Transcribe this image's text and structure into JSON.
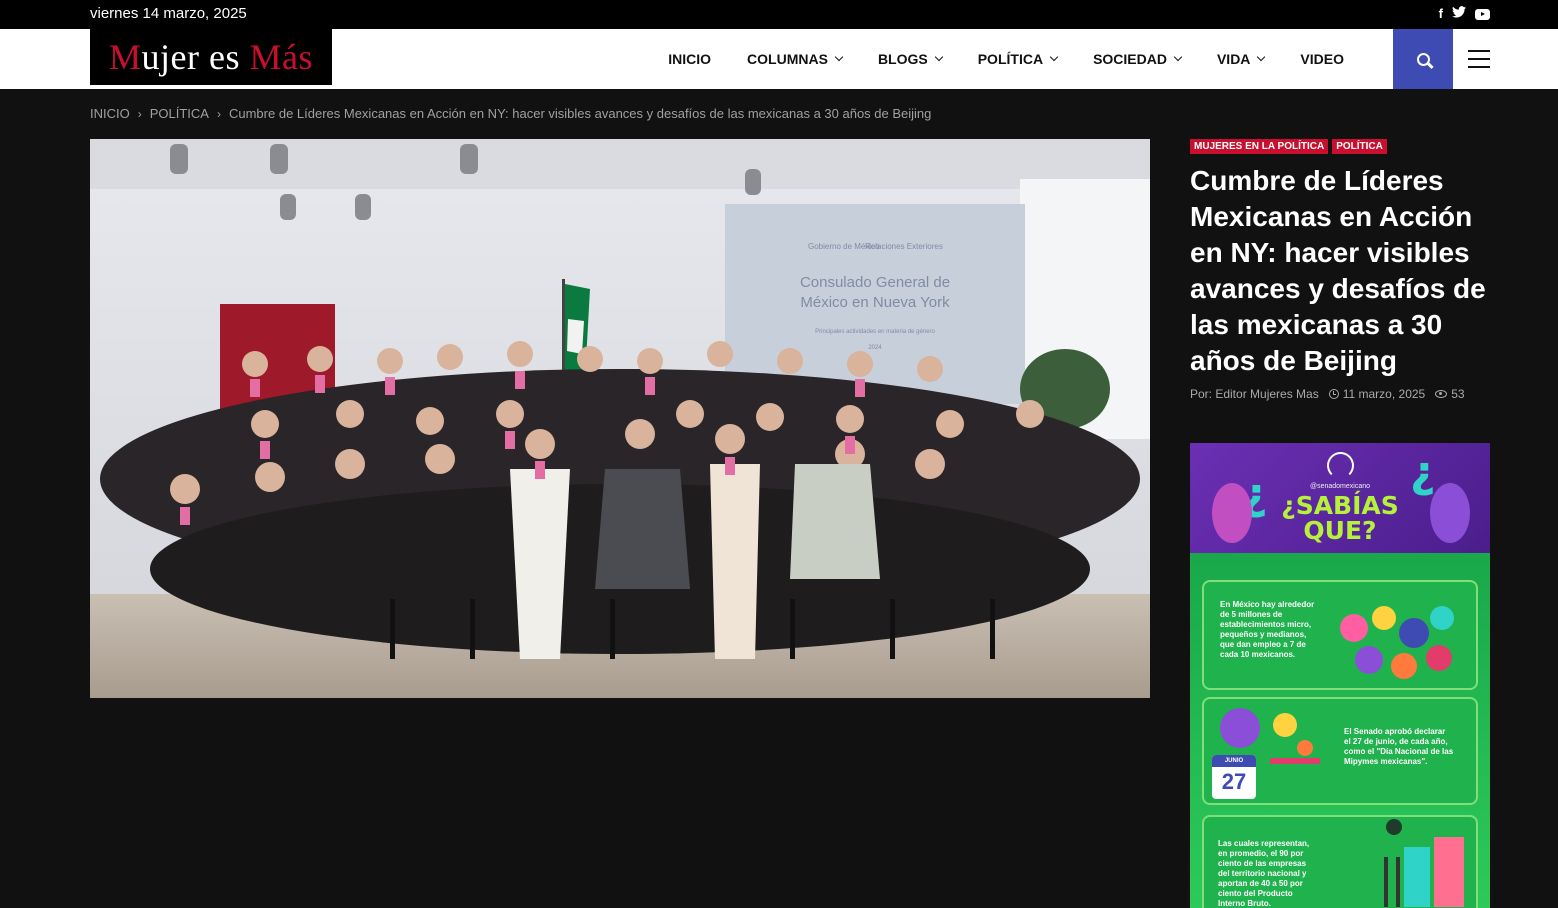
{
  "topbar": {
    "date": "viernes 14 marzo, 2025",
    "social": [
      "facebook-icon",
      "twitter-icon",
      "youtube-icon"
    ]
  },
  "header": {
    "logo": {
      "part1": "M",
      "part2": "ujer es ",
      "part3": "Más"
    },
    "nav": [
      {
        "label": "INICIO",
        "dropdown": false
      },
      {
        "label": "COLUMNAS",
        "dropdown": true
      },
      {
        "label": "BLOGS",
        "dropdown": true
      },
      {
        "label": "POLÍTICA",
        "dropdown": true
      },
      {
        "label": "SOCIEDAD",
        "dropdown": true
      },
      {
        "label": "VIDA",
        "dropdown": true
      },
      {
        "label": "VIDEO",
        "dropdown": false
      }
    ],
    "search_icon": "search-icon",
    "menu_icon": "hamburger-icon",
    "accent_color": "#3e4bb3"
  },
  "breadcrumb": {
    "home": "INICIO",
    "section": "POLÍTICA",
    "current": "Cumbre de Líderes Mexicanas en Acción en NY: hacer visibles avances y desafíos de las mexicanas a 30 años de Beijing"
  },
  "hero": {
    "screen_line1": "Consulado General de",
    "screen_line2": "México en Nueva York",
    "screen_sub": "Principales actividades en materia de género",
    "screen_year": "2024",
    "screen_brand1": "Gobierno de México",
    "screen_brand2": "Relaciones Exteriores"
  },
  "article": {
    "tags": [
      "MUJERES EN LA POLÍTICA",
      "POLÍTICA"
    ],
    "tag_color": "#c8102e",
    "title": "Cumbre de Líderes Mexicanas en Acción en NY: hacer visibles avances y desafíos de las mexicanas a 30 años de Beijing",
    "author": "Por: Editor Mujeres Mas",
    "date": "11 marzo, 2025",
    "views": "53"
  },
  "ad": {
    "handle": "@senadomexicano",
    "title_line1": "¿SABÍAS",
    "title_line2": "QUE?",
    "panel1": "En México hay alrededor de 5 millones de establecimientos micro, pequeños y medianos, que dan empleo a 7 de cada 10 mexicanos.",
    "panel2": "El Senado aprobó declarar el 27 de junio, de cada año, como el \"Día Nacional de las Mipymes mexicanas\".",
    "panel3": "Las cuales representan, en promedio, el 90 por ciento de las empresas del territorio nacional y aportan de 40 a 50 por ciento del Producto Interno Bruto.",
    "cal_month": "JUNIO",
    "cal_day": "27"
  }
}
